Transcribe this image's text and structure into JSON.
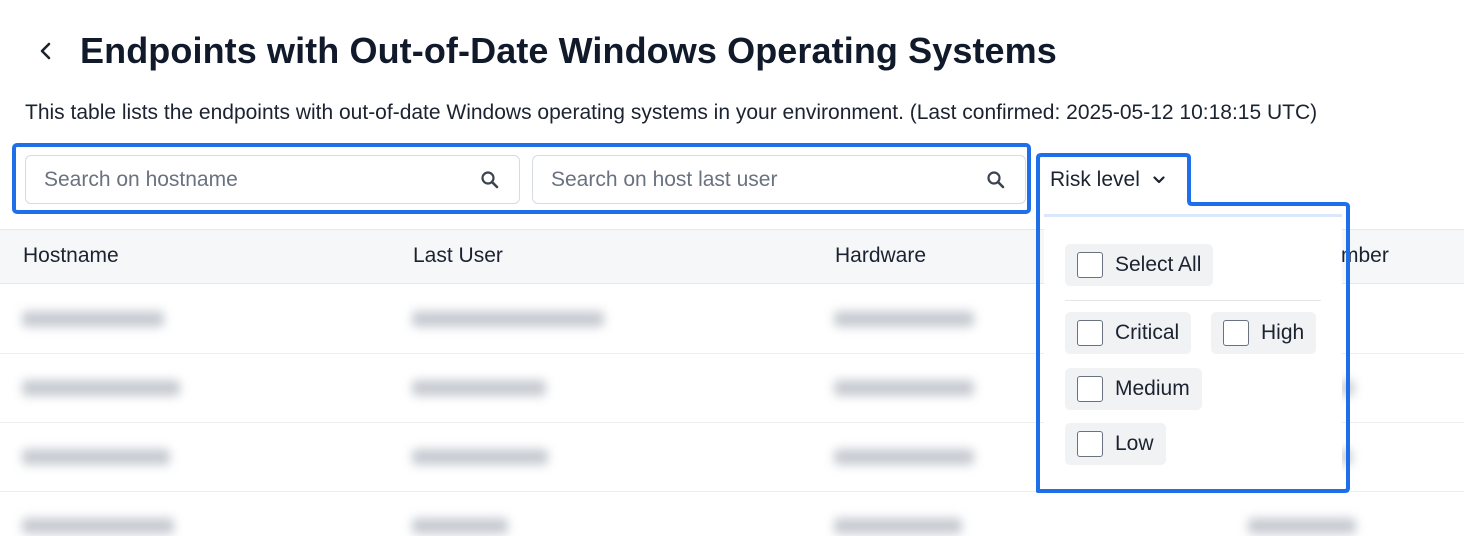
{
  "header": {
    "title": "Endpoints with Out-of-Date Windows Operating Systems",
    "description": "This table lists the endpoints with out-of-date Windows operating systems in your environment. (Last confirmed: 2025-05-12 10:18:15 UTC)"
  },
  "filters": {
    "hostname_placeholder": "Search on hostname",
    "last_user_placeholder": "Search on host last user",
    "risk_label": "Risk level"
  },
  "table": {
    "columns": [
      "Hostname",
      "Last User",
      "Hardware",
      "mber"
    ]
  },
  "risk_dropdown": {
    "select_all": "Select All",
    "options": [
      "Critical",
      "High",
      "Medium",
      "Low"
    ]
  },
  "colors": {
    "highlight": "#1f6fe8"
  }
}
